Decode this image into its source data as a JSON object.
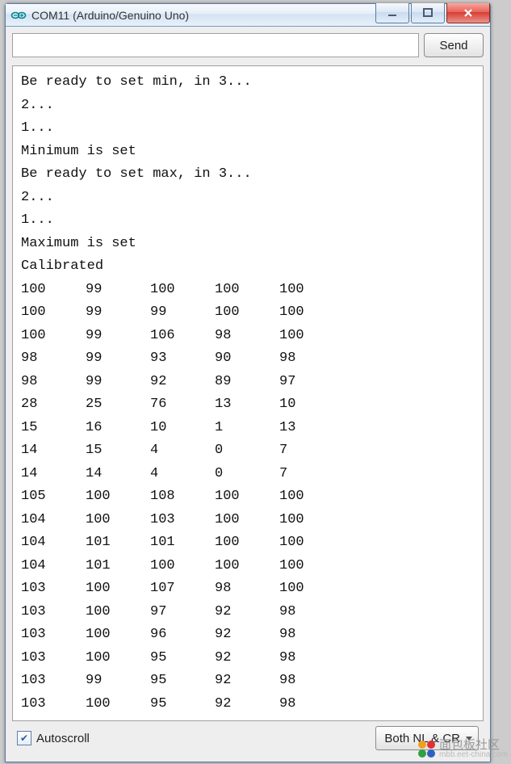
{
  "window": {
    "title": "COM11 (Arduino/Genuino Uno)"
  },
  "toolbar": {
    "send_label": "Send",
    "input_value": ""
  },
  "console": {
    "lines": [
      "Be ready to set min, in 3...",
      "2...",
      "1...",
      "Minimum is set",
      "Be ready to set max, in 3...",
      "2...",
      "1...",
      "Maximum is set",
      "Calibrated"
    ],
    "table": [
      [
        100,
        99,
        100,
        100,
        100
      ],
      [
        100,
        99,
        99,
        100,
        100
      ],
      [
        100,
        99,
        106,
        98,
        100
      ],
      [
        98,
        99,
        93,
        90,
        98
      ],
      [
        98,
        99,
        92,
        89,
        97
      ],
      [
        28,
        25,
        76,
        13,
        10
      ],
      [
        15,
        16,
        10,
        1,
        13
      ],
      [
        14,
        15,
        4,
        0,
        7
      ],
      [
        14,
        14,
        4,
        0,
        7
      ],
      [
        105,
        100,
        108,
        100,
        100
      ],
      [
        104,
        100,
        103,
        100,
        100
      ],
      [
        104,
        101,
        101,
        100,
        100
      ],
      [
        104,
        101,
        100,
        100,
        100
      ],
      [
        103,
        100,
        107,
        98,
        100
      ],
      [
        103,
        100,
        97,
        92,
        98
      ],
      [
        103,
        100,
        96,
        92,
        98
      ],
      [
        103,
        100,
        95,
        92,
        98
      ],
      [
        103,
        99,
        95,
        92,
        98
      ],
      [
        103,
        100,
        95,
        92,
        98
      ]
    ]
  },
  "footer": {
    "autoscroll_label": "Autoscroll",
    "autoscroll_checked": true,
    "line_ending_selected": "Both NL & CR"
  },
  "watermark": {
    "text": "面包板社区",
    "sub": "mbb.eet-china.com"
  }
}
